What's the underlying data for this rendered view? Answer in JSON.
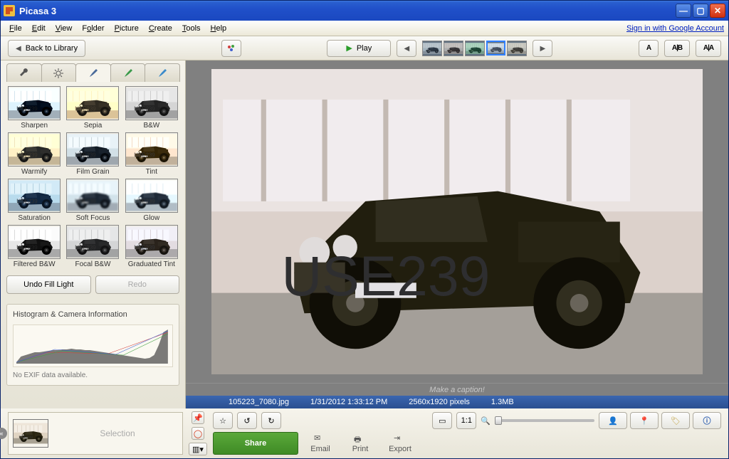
{
  "window": {
    "title": "Picasa 3"
  },
  "menu": {
    "file": "File",
    "edit": "Edit",
    "view": "View",
    "folder": "Folder",
    "picture": "Picture",
    "create": "Create",
    "tools": "Tools",
    "help": "Help",
    "signin": "Sign in with Google Account"
  },
  "toolbar": {
    "back": "Back to Library",
    "play": "Play"
  },
  "view_btns": {
    "a": "A",
    "ab": "A|B",
    "aa": "A|A"
  },
  "effects": [
    {
      "label": "Sharpen"
    },
    {
      "label": "Sepia"
    },
    {
      "label": "B&W"
    },
    {
      "label": "Warmify"
    },
    {
      "label": "Film Grain"
    },
    {
      "label": "Tint"
    },
    {
      "label": "Saturation"
    },
    {
      "label": "Soft Focus"
    },
    {
      "label": "Glow"
    },
    {
      "label": "Filtered B&W"
    },
    {
      "label": "Focal B&W"
    },
    {
      "label": "Graduated Tint"
    }
  ],
  "undo": {
    "undo_label": "Undo Fill Light",
    "redo_label": "Redo"
  },
  "histogram": {
    "title": "Histogram & Camera Information",
    "exif": "No EXIF data available."
  },
  "caption": "Make a caption!",
  "status": {
    "filename": "105223_7080.jpg",
    "datetime": "1/31/2012 1:33:12 PM",
    "dimensions": "2560x1920 pixels",
    "size": "1.3MB"
  },
  "selection": {
    "label": "Selection"
  },
  "bottom": {
    "share": "Share",
    "email": "Email",
    "print": "Print",
    "export": "Export"
  },
  "thumb_colors": [
    "#506070",
    "#705040",
    "#209040",
    "#a0b0c8",
    "#907850"
  ],
  "effect_filters": [
    "contrast(1.3)",
    "sepia(1)",
    "grayscale(1)",
    "sepia(0.6) saturate(1.4)",
    "grayscale(0.2) contrast(1.1)",
    "hue-rotate(190deg) saturate(2) brightness(1.1)",
    "saturate(2.2)",
    "blur(1px) brightness(1.05)",
    "brightness(1.15) blur(0.6px)",
    "grayscale(1) contrast(1.2)",
    "grayscale(0.9)",
    "sepia(0.2) hue-rotate(180deg)"
  ]
}
